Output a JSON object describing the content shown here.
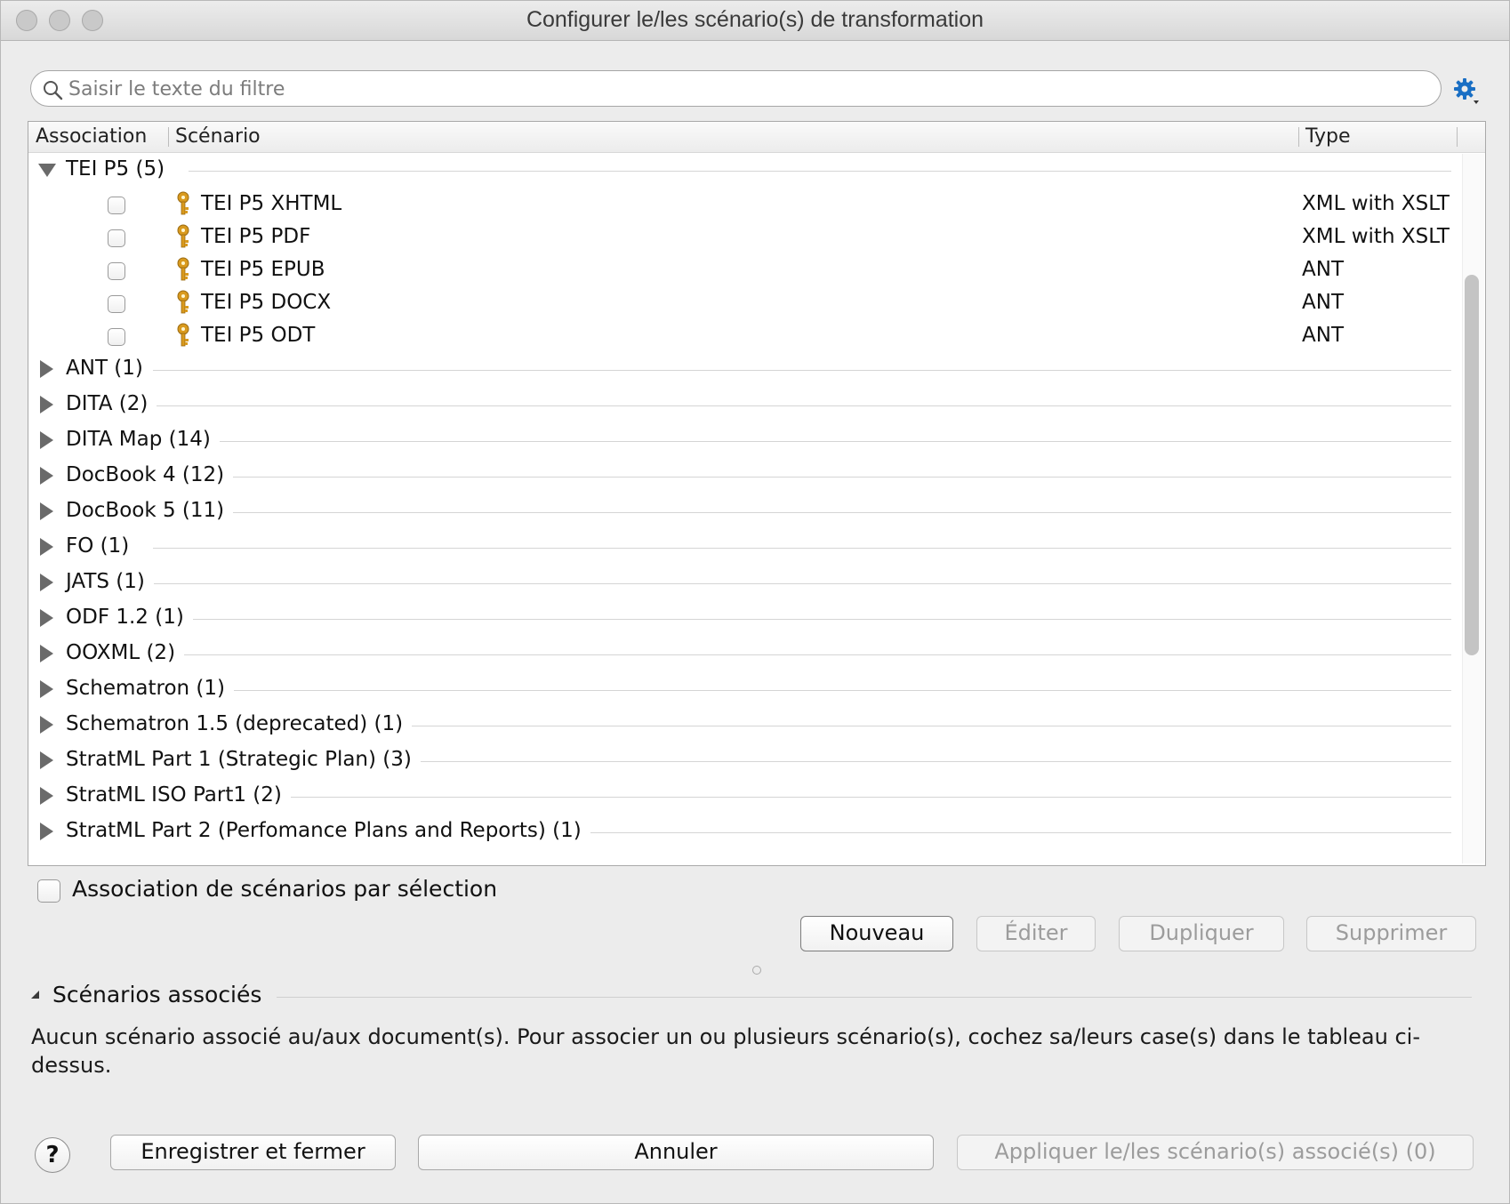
{
  "window": {
    "title": "Configurer le/les scénario(s) de transformation"
  },
  "filter": {
    "placeholder": "Saisir le texte du filtre"
  },
  "columns": {
    "association": "Association",
    "scenario": "Scénario",
    "type": "Type"
  },
  "expanded_group": {
    "label": "TEI P5 (5)",
    "scenarios": [
      {
        "name": "TEI P5 XHTML",
        "type": "XML with XSLT",
        "checked": false
      },
      {
        "name": "TEI P5 PDF",
        "type": "XML with XSLT",
        "checked": false
      },
      {
        "name": "TEI P5 EPUB",
        "type": "ANT",
        "checked": false
      },
      {
        "name": "TEI P5 DOCX",
        "type": "ANT",
        "checked": false
      },
      {
        "name": "TEI P5 ODT",
        "type": "ANT",
        "checked": false
      }
    ]
  },
  "collapsed_groups": [
    "ANT (1)",
    "DITA (2)",
    "DITA Map (14)",
    "DocBook 4 (12)",
    "DocBook 5 (11)",
    "FO (1)",
    "JATS (1)",
    "ODF 1.2 (1)",
    "OOXML (2)",
    "Schematron (1)",
    "Schematron 1.5 (deprecated) (1)",
    "StratML Part 1 (Strategic Plan) (3)",
    "StratML ISO Part1 (2)",
    "StratML Part 2 (Perfomance Plans and Reports) (1)"
  ],
  "association_checkbox": {
    "label": "Association de scénarios par sélection",
    "checked": false
  },
  "actions": {
    "new": "Nouveau",
    "edit": "Éditer",
    "duplicate": "Dupliquer",
    "delete": "Supprimer"
  },
  "associated_section": {
    "title": "Scénarios associés",
    "message": "Aucun scénario associé au/aux document(s). Pour associer un ou plusieurs scénario(s), cochez sa/leurs case(s) dans le tableau ci-dessus."
  },
  "footer": {
    "help": "?",
    "save_close": "Enregistrer et fermer",
    "cancel": "Annuler",
    "apply": "Appliquer le/les scénario(s) associé(s) (0)"
  },
  "colors": {
    "gear_accent": "#1a6fc4",
    "key_gold": "#d99a1e",
    "disabled_text": "#9c9c9c"
  }
}
